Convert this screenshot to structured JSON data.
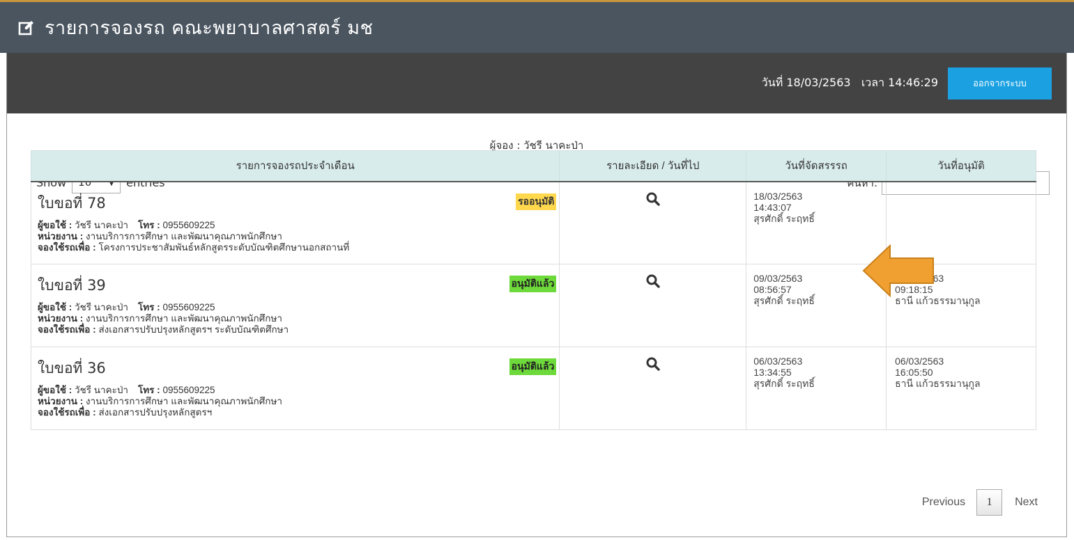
{
  "header": {
    "title": "รายการจองรถ คณะพยาบาลศาสตร์ มช",
    "title_icon": "edit-icon"
  },
  "topbar": {
    "date_time": "วันที่ 18/03/2563   เวลา 14:46:29",
    "logout_label": "ออกจากระบบ"
  },
  "booker": "ผู้จอง : วัชรี นาคะป่า",
  "controls": {
    "show_label": "Show",
    "entries_value": "10",
    "entries_label": "entries",
    "search_label": "ค้นหา:",
    "search_value": ""
  },
  "table": {
    "headers": [
      "รายการจองรถประจำเดือน",
      "รายละเอียด / วันที่ไป",
      "วันที่จัดสรรรถ",
      "วันที่อนุมัติ"
    ],
    "rows": [
      {
        "title": "ใบขอที่ 78",
        "status": "รออนุมัติ",
        "user_label": "ผู้ขอใช้ :",
        "user": "วัชรี นาคะป่า",
        "phone_label": "โทร :",
        "phone": "0955609225",
        "unit_label": "หน่วยงาน :",
        "unit": "งานบริการการศึกษา และพัฒนาคุณภาพนักศึกษา",
        "purpose_label": "จองใช้รถเพื่อ :",
        "purpose": "โครงการประชาสัมพันธ์หลักสูตรระดับบัณฑิตศึกษานอกสถานที่",
        "alloc_date": "18/03/2563",
        "alloc_time": "14:43:07",
        "alloc_by": "สุรศักดิ์ ระฤทธิ์",
        "approve_date": "",
        "approve_time": "",
        "approve_by": ""
      },
      {
        "title": "ใบขอที่ 39",
        "status": "อนุมัติแล้ว",
        "user_label": "ผู้ขอใช้ :",
        "user": "วัชรี นาคะป่า",
        "phone_label": "โทร :",
        "phone": "0955609225",
        "unit_label": "หน่วยงาน :",
        "unit": "งานบริการการศึกษา และพัฒนาคุณภาพนักศึกษา",
        "purpose_label": "จองใช้รถเพื่อ :",
        "purpose": "ส่งเอกสารปรับปรุงหลักสูตรฯ ระดับบัณฑิตศึกษา",
        "alloc_date": "09/03/2563",
        "alloc_time": "08:56:57",
        "alloc_by": "สุรศักดิ์ ระฤทธิ์",
        "approve_date": "09/03/2563",
        "approve_time": "09:18:15",
        "approve_by": "ธานี แก้วธรรมานุกูล"
      },
      {
        "title": "ใบขอที่ 36",
        "status": "อนุมัติแล้ว",
        "user_label": "ผู้ขอใช้ :",
        "user": "วัชรี นาคะป่า",
        "phone_label": "โทร :",
        "phone": "0955609225",
        "unit_label": "หน่วยงาน :",
        "unit": "งานบริการการศึกษา และพัฒนาคุณภาพนักศึกษา",
        "purpose_label": "จองใช้รถเพื่อ :",
        "purpose": "ส่งเอกสารปรับปรุงหลักสูตรฯ",
        "alloc_date": "06/03/2563",
        "alloc_time": "13:34:55",
        "alloc_by": "สุรศักดิ์ ระฤทธิ์",
        "approve_date": "06/03/2563",
        "approve_time": "16:05:50",
        "approve_by": "ธานี แก้วธรรมานุกูล"
      }
    ]
  },
  "pagination": {
    "previous": "Previous",
    "current": "1",
    "next": "Next"
  },
  "colors": {
    "title_bar": "#4a5560",
    "panel_head": "#434343",
    "logout_button": "#1ba1e2",
    "status_pending": "#ffd84d",
    "status_approved": "#6dd93a",
    "header_row": "#d9ecec",
    "annotation_arrow": "#f0a030"
  }
}
